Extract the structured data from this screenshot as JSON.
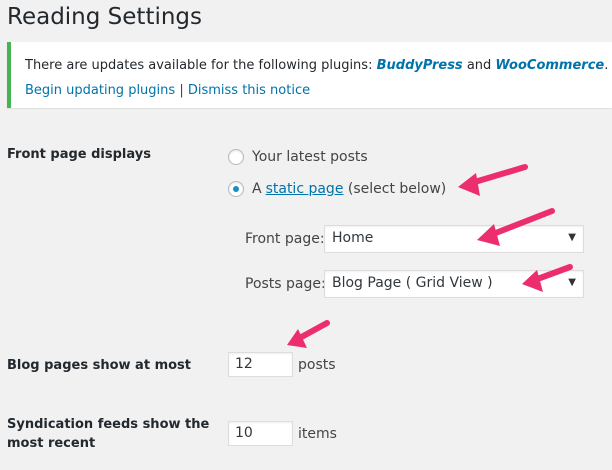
{
  "page": {
    "title": "Reading Settings"
  },
  "notice": {
    "prefix": "There are updates available for the following plugins: ",
    "plugin1": "BuddyPress",
    "conj": " and ",
    "plugin2": "WooCommerce",
    "suffix": ".",
    "begin_link": "Begin updating plugins",
    "separator": " | ",
    "dismiss_link": "Dismiss this notice",
    "accent_color": "#46b450"
  },
  "front_page_displays": {
    "label": "Front page displays",
    "option_latest": "Your latest posts",
    "option_static_prefix": "A ",
    "option_static_link": "static page",
    "option_static_suffix": " (select below)",
    "selected": "static"
  },
  "front_page_select": {
    "label": "Front page:",
    "value": "Home"
  },
  "posts_page_select": {
    "label": "Posts page:",
    "value": "Blog Page ( Grid View )"
  },
  "blog_pages": {
    "label": "Blog pages show at most",
    "value": "12",
    "suffix": "posts"
  },
  "syndication": {
    "label_line1": "Syndication feeds show the",
    "label_line2": "most recent",
    "value": "10",
    "suffix": "items"
  },
  "annotation": {
    "arrow_color": "#ec2d6e"
  },
  "icons": {
    "select_arrow": "triangle-down-icon"
  }
}
